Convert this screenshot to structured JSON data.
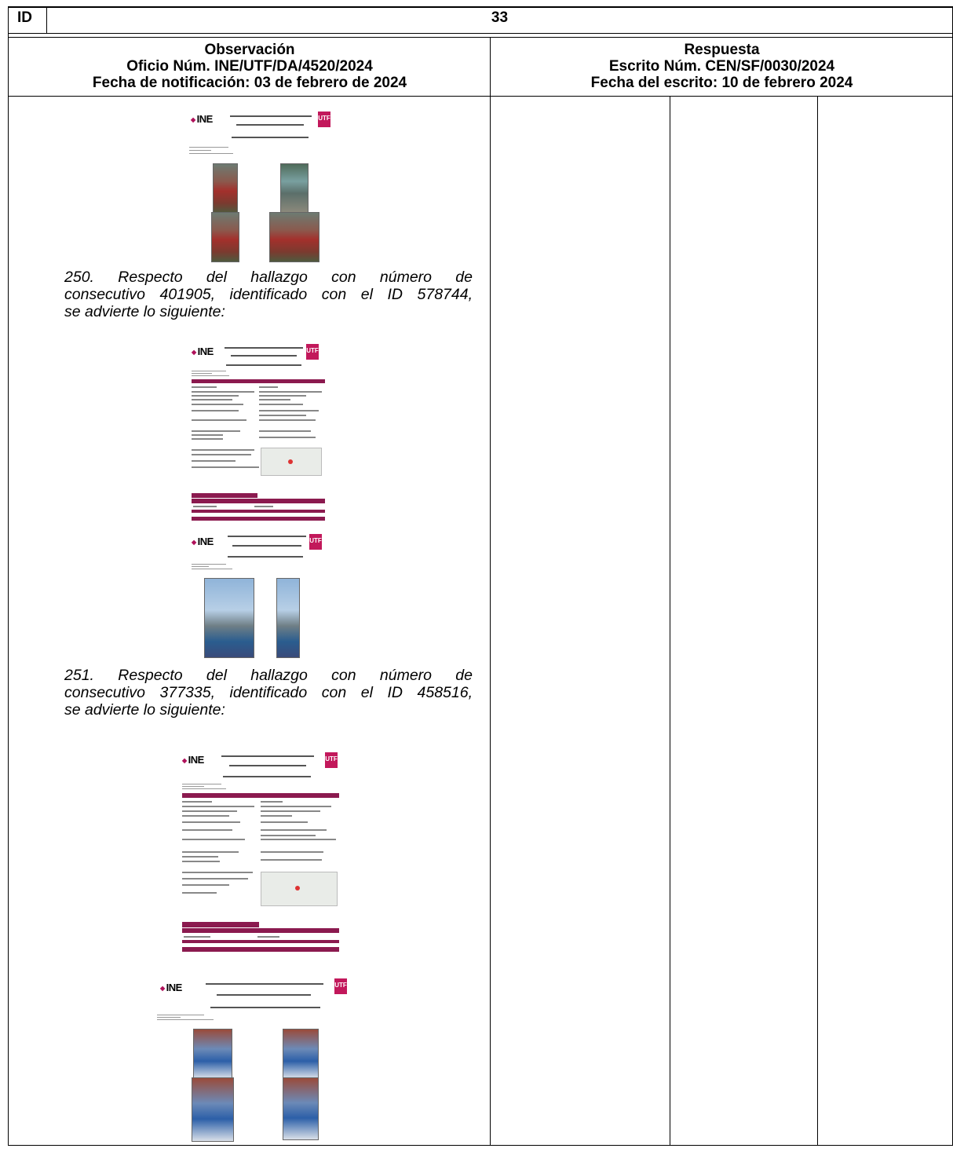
{
  "table": {
    "id_label": "ID",
    "id_value": "33"
  },
  "observacion": {
    "heading": "Observación",
    "oficio": "Oficio Núm. INE/UTF/DA/4520/2024",
    "fecha": "Fecha de notificación: 03 de febrero de 2024"
  },
  "respuesta": {
    "heading": "Respuesta",
    "escrito": "Escrito Núm. CEN/SF/0030/2024",
    "fecha": "Fecha del escrito: 10 de febrero 2024"
  },
  "paragraphs": [
    {
      "lines": [
        "250. Respecto del hallazgo con número de",
        "consecutivo 401905, identificado con el ID 578744,",
        "se advierte lo siguiente:"
      ]
    },
    {
      "lines": [
        "251. Respecto del hallazgo con número de",
        "consecutivo 377335, identificado con el ID 458516,",
        "se advierte lo siguiente:"
      ]
    }
  ],
  "thumbnails": {
    "brand": "INE",
    "badge": "UTF"
  }
}
